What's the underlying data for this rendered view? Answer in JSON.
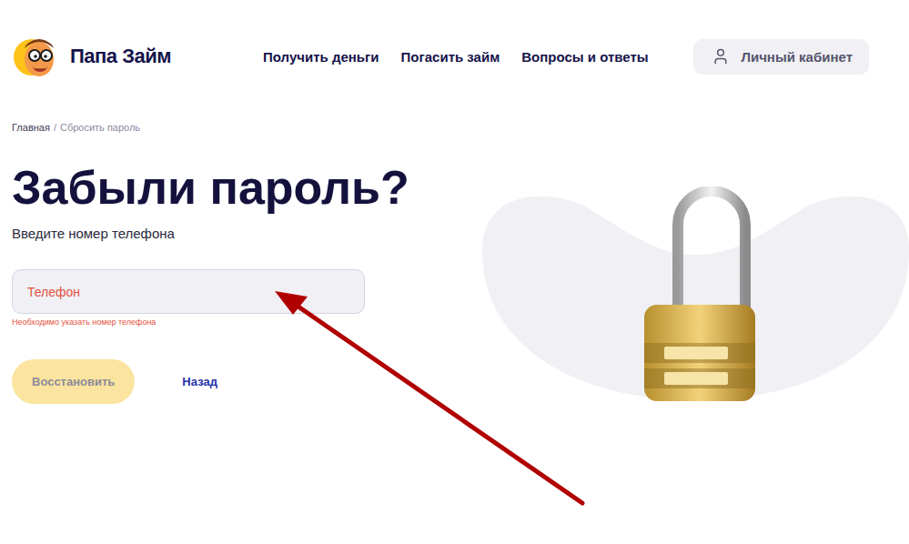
{
  "header": {
    "logo": {
      "text": "Папа Займ"
    },
    "nav": [
      {
        "label": "Получить деньги"
      },
      {
        "label": "Погасить займ"
      },
      {
        "label": "Вопросы и ответы"
      }
    ],
    "account_button": {
      "label": "Личный кабинет"
    }
  },
  "breadcrumbs": [
    {
      "label": "Главная",
      "current": false
    },
    {
      "label": "Сбросить пароль",
      "current": true
    }
  ],
  "breadcrumb_separator": "/",
  "form": {
    "title": "Забыли пароль?",
    "subtitle": "Введите номер телефона",
    "phone_field": {
      "placeholder": "Телефон",
      "value": "",
      "error": true,
      "error_text": "Необходимо указать номер телефона"
    },
    "buttons": [
      {
        "label": "Восстановить",
        "kind": "primary",
        "disabled": true
      },
      {
        "label": "Назад",
        "kind": "link",
        "disabled": false
      }
    ]
  }
}
